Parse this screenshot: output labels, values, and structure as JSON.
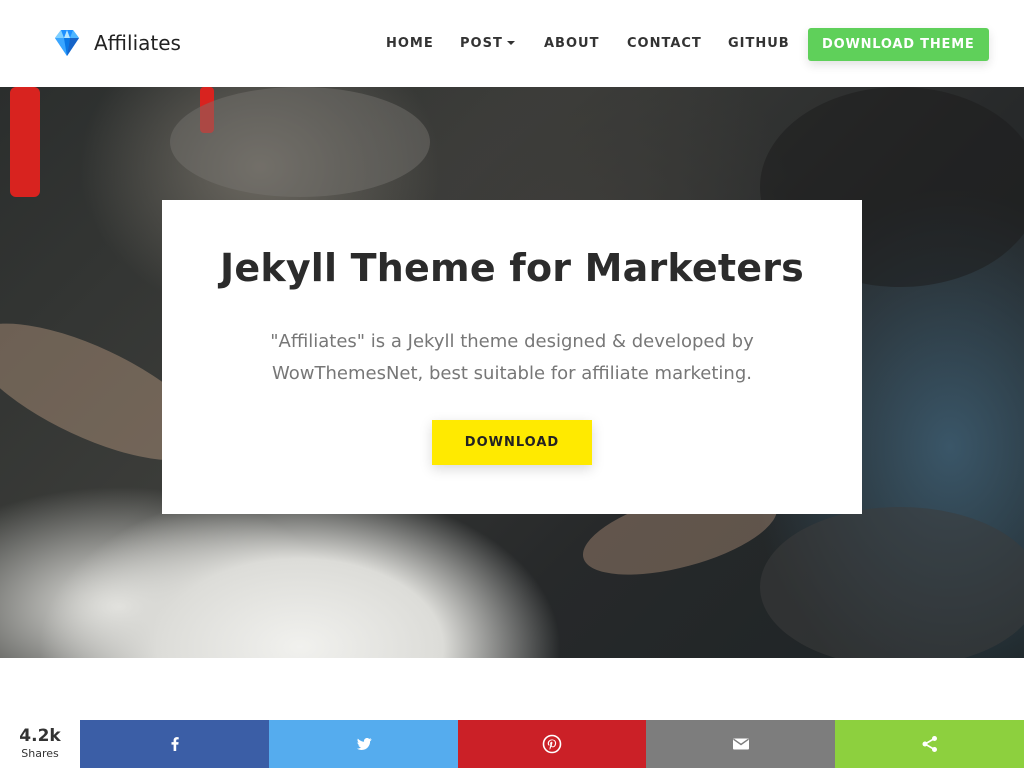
{
  "header": {
    "brand": {
      "name": "Affiliates",
      "icon": "diamond-icon"
    },
    "nav": [
      {
        "label": "HOME"
      },
      {
        "label": "POST",
        "has_dropdown": true
      },
      {
        "label": "ABOUT"
      },
      {
        "label": "CONTACT"
      },
      {
        "label": "GITHUB"
      }
    ],
    "cta": {
      "label": "DOWNLOAD THEME",
      "color": "#5fd05a"
    }
  },
  "hero": {
    "title": "Jekyll Theme for Marketers",
    "text": "\"Affiliates\" is a Jekyll theme designed & developed by WowThemesNet, best suitable for affiliate marketing.",
    "button": {
      "label": "DOWNLOAD",
      "color": "#ffea00"
    }
  },
  "share": {
    "count": "4.2k",
    "count_label": "Shares",
    "buttons": [
      {
        "network": "facebook",
        "icon": "facebook-icon",
        "color": "#3b5ea6"
      },
      {
        "network": "twitter",
        "icon": "twitter-icon",
        "color": "#55acee"
      },
      {
        "network": "pinterest",
        "icon": "pinterest-icon",
        "color": "#cb2027"
      },
      {
        "network": "email",
        "icon": "email-icon",
        "color": "#7d7d7d"
      },
      {
        "network": "share",
        "icon": "share-icon",
        "color": "#8dd03e"
      }
    ]
  }
}
